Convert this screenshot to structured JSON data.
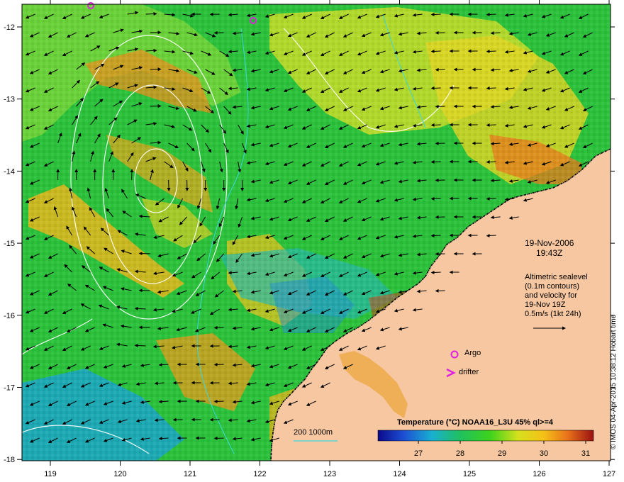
{
  "map": {
    "x_ticks": [
      "119",
      "120",
      "121",
      "122",
      "123",
      "124",
      "125",
      "126",
      "127"
    ],
    "y_ticks": [
      "-12",
      "-13",
      "-14",
      "-15",
      "-16",
      "-17",
      "-18"
    ],
    "date": "19-Nov-2006",
    "time": "19:43Z",
    "altimetry_lines": [
      "Altimetric sealevel",
      "(0.1m contours)",
      "and velocity for",
      "19-Nov 19Z",
      "0.5m/s (1kt 24h)"
    ],
    "argo_label": "Argo",
    "drifter_label": "drifter",
    "depth_scale": "200  1000m",
    "legend": {
      "title": "Temperature (°C) NOAA16_L3U 45% ql>=4",
      "ticks": [
        "27",
        "28",
        "29",
        "30",
        "31"
      ]
    },
    "credit": "© IMOS 04-Apr-2015 10:38:12 Hobart time",
    "colors": {
      "land": "#f6c7a0",
      "ocean_mid": "#2bc13b",
      "warm": "#f7d21e",
      "hot": "#e8831d",
      "cool": "#1aa5c9",
      "argo": "#e020e0"
    }
  }
}
